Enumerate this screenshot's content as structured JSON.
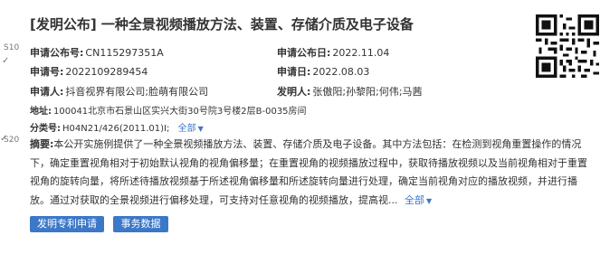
{
  "title": "[发明公布] 一种全景视频播放方法、装置、存储介质及电子设备",
  "fields": {
    "pub_no_label": "申请公布号:",
    "pub_no": "CN115297351A",
    "pub_date_label": "申请公布日:",
    "pub_date": "2022.11.04",
    "app_no_label": "申请号:",
    "app_no": "2022109289454",
    "app_date_label": "申请日:",
    "app_date": "2022.08.03",
    "applicant_label": "申请人:",
    "applicant": "抖音视界有限公司;脸萌有限公司",
    "inventor_label": "发明人:",
    "inventor": "张傲阳;孙黎阳;何伟;马茜",
    "address_label": "地址:",
    "address": "100041北京市石景山区实兴大街30号院3号楼2层B-0035房间",
    "class_label": "分类号:",
    "class_no": "H04N21/426(2011.01)I;",
    "class_all": "全部"
  },
  "abstract": {
    "label": "摘要:",
    "text": "本公开实施例提供了一种全景视频播放方法、装置、存储介质及电子设备。其中方法包括：在检测到视角重置操作的情况下，确定重置视角相对于初始默认视角的视角偏移量；在重置视角的视频播放过程中，获取待播放视频以及当前视角相对于重置视角的旋转向量，将所述待播放视频基于所述视角偏移量和所述旋转向量进行处理，确定当前视角对应的播放视频，并进行播放。通过对获取的全景视频进行偏移处理，可支持对任意视角的视频播放，提高视...",
    "more": "全部"
  },
  "buttons": {
    "apply": "发明专利申请",
    "affairs": "事务数据"
  },
  "left_edge": {
    "frag1": "S10",
    "frag2": "S20"
  }
}
